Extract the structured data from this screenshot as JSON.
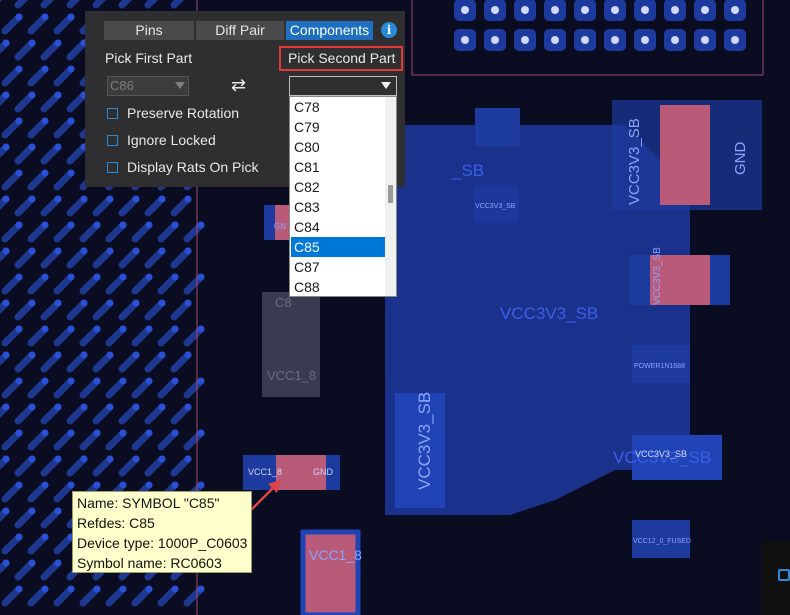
{
  "canvas": {
    "labels": {
      "vcc3v3_sb": "VCC3V3_SB",
      "gnd": "GND",
      "vcc1_8": "VCC1_8",
      "gn_partial": "GN",
      "vcc3v3_sb_partial": "_SB",
      "vc_partial": "VC",
      "power_net": "POWER1N1688",
      "vcc12_fused": "VCC12_0_FUSED",
      "c8_partial": "C8",
      "vcc1_partial": "VCC1_8"
    },
    "colors": {
      "background": "#0a0c22",
      "copper": "#1d3a9e",
      "copper_dark": "#18307e",
      "pad": "#b85a78",
      "via": "#2a50d6",
      "trace": "#1e3890",
      "label": "#3a5ee8"
    }
  },
  "panel": {
    "tabs": [
      {
        "label": "Pins",
        "active": false
      },
      {
        "label": "Diff Pair",
        "active": false
      },
      {
        "label": "Components",
        "active": true
      }
    ],
    "info_icon": "info-icon",
    "pick_first": {
      "label": "Pick First Part",
      "value": "C86"
    },
    "swap_icon": "swap-arrows-icon",
    "checkboxes": [
      {
        "label": "Preserve Rotation",
        "checked": false
      },
      {
        "label": "Ignore Locked",
        "checked": false
      },
      {
        "label": "Display Rats On Pick",
        "checked": false
      }
    ],
    "pick_second": {
      "label": "Pick Second Part",
      "value": "",
      "options": [
        "C78",
        "C79",
        "C80",
        "C81",
        "C82",
        "C83",
        "C84",
        "C85",
        "C87",
        "C88"
      ],
      "selected": "C85"
    }
  },
  "tooltip": {
    "lines": [
      "Name: SYMBOL \"C85\"",
      "Refdes: C85",
      "Device type: 1000P_C0603",
      "Symbol name: RC0603"
    ]
  },
  "colors": {
    "accent": "#1f6fc0",
    "highlight_border": "#e53935",
    "arrow": "#e04545",
    "tooltip_bg": "#ffffcc"
  }
}
